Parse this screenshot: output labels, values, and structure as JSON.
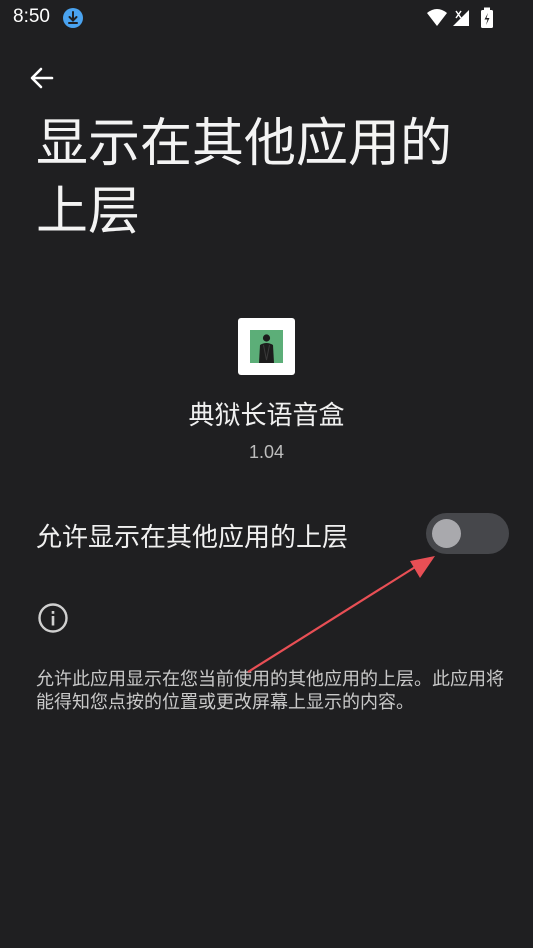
{
  "status_bar": {
    "time": "8:50",
    "icons": [
      "download-icon",
      "wifi-icon",
      "signal-icon",
      "battery-icon"
    ]
  },
  "header": {
    "back_icon": "arrow-left-icon",
    "title": "显示在其他应用的上层"
  },
  "app": {
    "name": "典狱长语音盒",
    "version": "1.04"
  },
  "permission": {
    "label": "允许显示在其他应用的上层",
    "enabled": false
  },
  "info": {
    "icon": "info-icon",
    "description": "允许此应用显示在您当前使用的其他应用的上层。此应用将能得知您点按的位置或更改屏幕上显示的内容。"
  },
  "colors": {
    "background": "#1f1f21",
    "toggle_track": "#46474b",
    "toggle_thumb": "#a9a9ad",
    "annotation_arrow": "#e84f55",
    "app_icon_art": "#5cae78"
  }
}
